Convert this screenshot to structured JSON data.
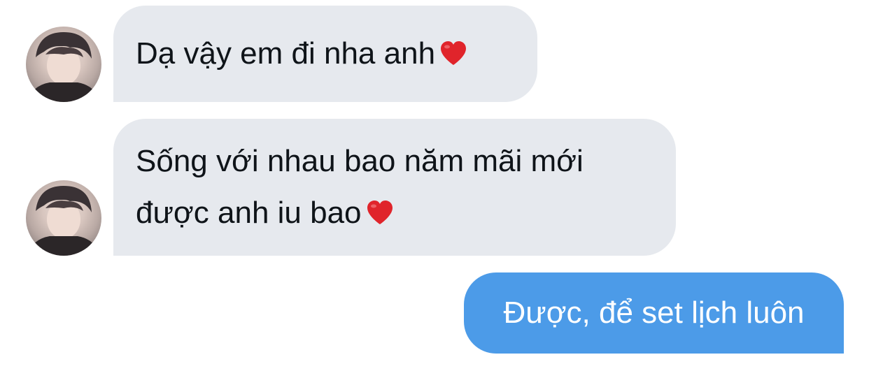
{
  "colors": {
    "incoming_bubble": "#e6e9ee",
    "outgoing_bubble": "#4c9be8",
    "heart": "#e0242b"
  },
  "messages": [
    {
      "direction": "incoming",
      "avatar_icon": "user-avatar",
      "lines": [
        "Dạ vậy em đi nha anh"
      ],
      "emoji": "red-heart-icon"
    },
    {
      "direction": "incoming",
      "avatar_icon": "user-avatar",
      "lines": [
        "Sống với nhau bao năm mãi mới",
        "được anh iu bao"
      ],
      "emoji": "red-heart-icon"
    },
    {
      "direction": "outgoing",
      "lines": [
        "Được, để set lịch luôn"
      ]
    }
  ]
}
